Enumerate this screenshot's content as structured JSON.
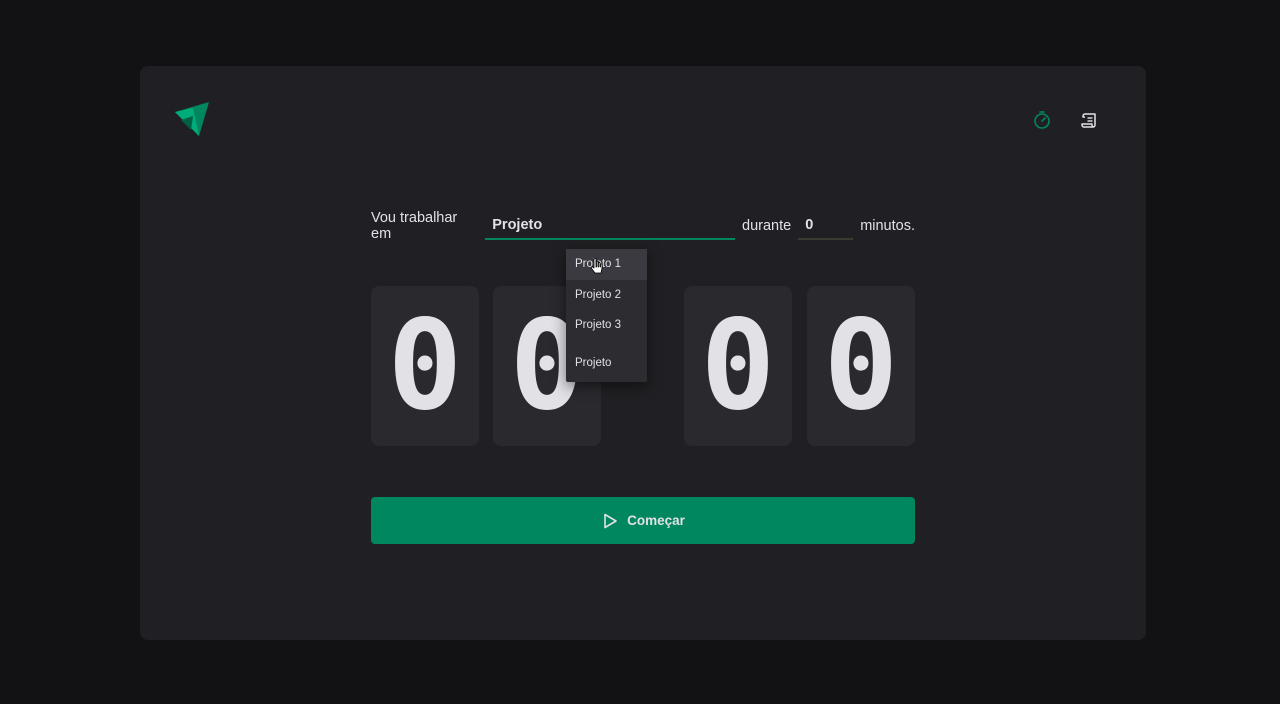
{
  "header": {
    "nav": [
      {
        "icon": "timer-icon",
        "color": "#00875f"
      },
      {
        "icon": "scroll-icon",
        "color": "#e1e1e6"
      }
    ]
  },
  "form": {
    "label_task": "Vou trabalhar em",
    "task_value": "Projeto",
    "label_during": "durante",
    "minutes_value": "0",
    "label_minutes": "minutos."
  },
  "suggestions": [
    "Projeto 1",
    "Projeto 2",
    "Projeto 3",
    "Projeto"
  ],
  "countdown": {
    "digits": [
      "0",
      "0",
      "0",
      "0"
    ],
    "separator": ":"
  },
  "start_button": {
    "label": "Começar",
    "icon": "play-icon"
  },
  "colors": {
    "accent": "#00875f",
    "background": "#121214",
    "panel": "#202024",
    "digit_bg": "#29292e",
    "text": "#e1e1e6"
  }
}
